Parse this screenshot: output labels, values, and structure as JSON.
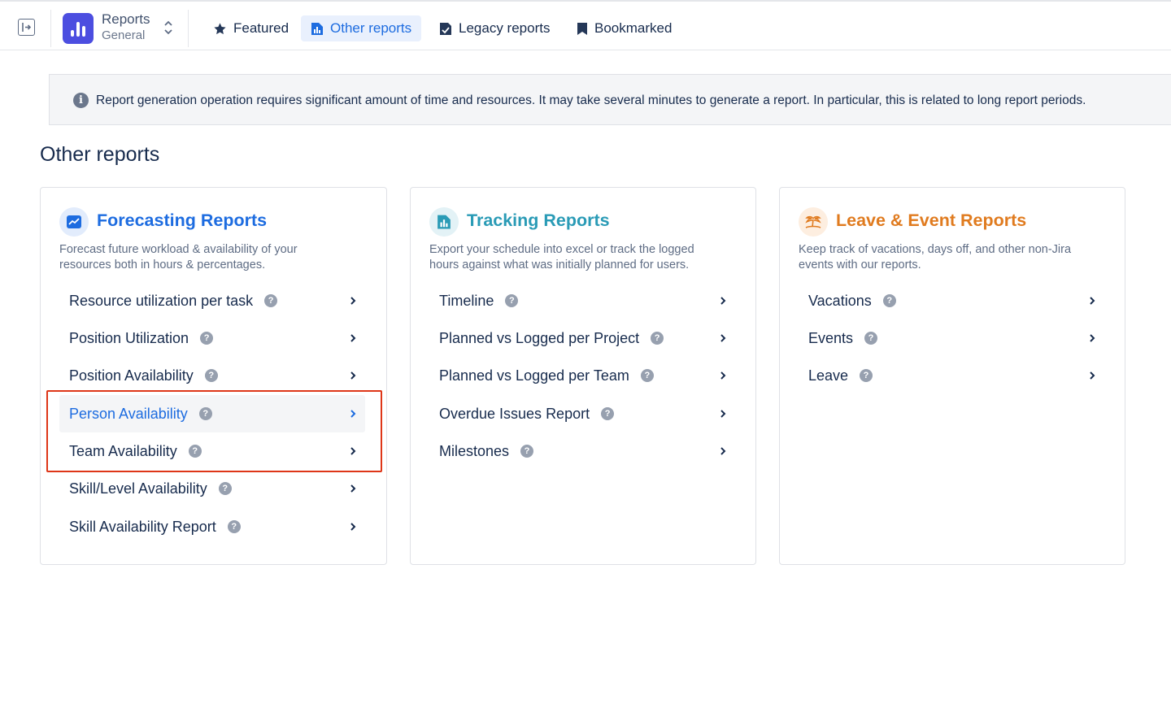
{
  "app": {
    "title": "Reports",
    "subtitle": "General"
  },
  "nav": {
    "tabs": [
      {
        "label": "Featured",
        "icon": "star-icon"
      },
      {
        "label": "Other reports",
        "icon": "report-chart-icon",
        "active": true
      },
      {
        "label": "Legacy reports",
        "icon": "legacy-doc-icon"
      },
      {
        "label": "Bookmarked",
        "icon": "bookmark-icon"
      }
    ]
  },
  "banner": {
    "text": "Report generation operation requires significant amount of time and resources. It may take several minutes to generate a report. In particular, this is related to long report periods."
  },
  "page": {
    "title": "Other reports"
  },
  "cards": [
    {
      "title": "Forecasting Reports",
      "color": "#1d6ce0",
      "icon": "trending-chart-icon",
      "description": "Forecast future workload & availability of your resources both in hours & percentages.",
      "items": [
        {
          "label": "Resource utilization per task"
        },
        {
          "label": "Position Utilization"
        },
        {
          "label": "Position Availability"
        },
        {
          "label": "Person Availability",
          "hovered": true
        },
        {
          "label": "Team Availability"
        },
        {
          "label": "Skill/Level Availability"
        },
        {
          "label": "Skill Availability Report"
        }
      ]
    },
    {
      "title": "Tracking Reports",
      "color": "#2a9bb6",
      "icon": "tracking-chart-icon",
      "description": "Export your schedule into excel or track the logged hours against what was initially planned for users.",
      "items": [
        {
          "label": "Timeline"
        },
        {
          "label": "Planned vs Logged per Project"
        },
        {
          "label": "Planned vs Logged per Team"
        },
        {
          "label": "Overdue Issues Report"
        },
        {
          "label": "Milestones"
        }
      ]
    },
    {
      "title": "Leave & Event Reports",
      "color": "#e07b1f",
      "icon": "island-icon",
      "description": "Keep track of vacations, days off, and other non-Jira events with our reports.",
      "items": [
        {
          "label": "Vacations"
        },
        {
          "label": "Events"
        },
        {
          "label": "Leave"
        }
      ]
    }
  ],
  "colors": {
    "accent": "#1d6ce0",
    "highlight_border": "#de3618"
  }
}
